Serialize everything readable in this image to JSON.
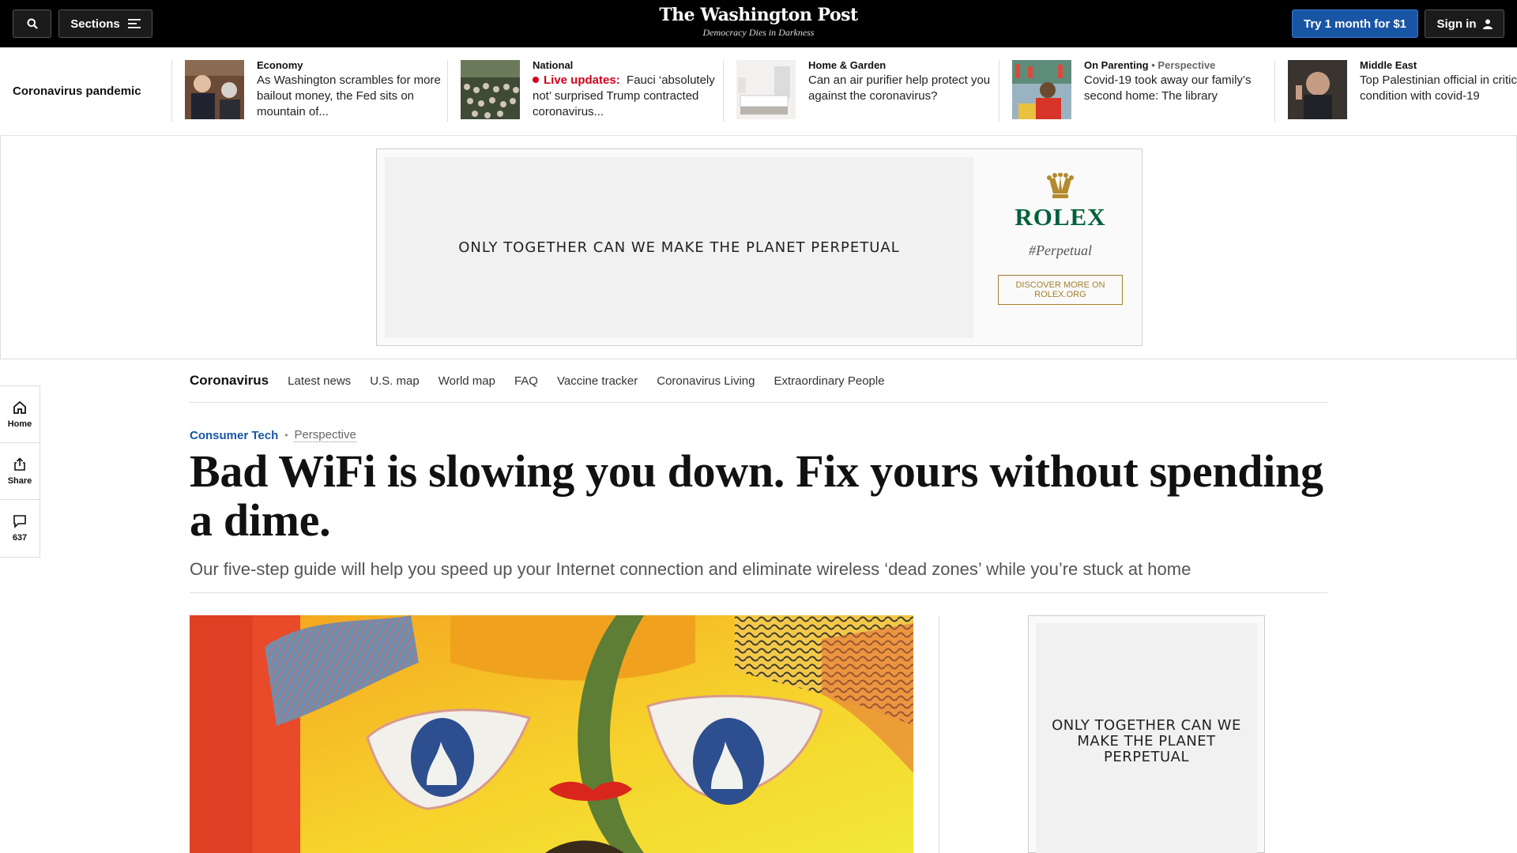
{
  "topbar": {
    "sections_label": "Sections",
    "logo": "The Washington Post",
    "tagline": "Democracy Dies in Darkness",
    "subscribe_label": "Try 1 month for $1",
    "signin_label": "Sign in",
    "icons": [
      "search-icon",
      "menu-icon",
      "user-icon"
    ]
  },
  "strip": {
    "title": "Coronavirus pandemic",
    "items": [
      {
        "kicker": "Economy",
        "headline": "As Washington scrambles for more bailout money, the Fed sits on mountain of..."
      },
      {
        "kicker": "National",
        "live": "Live updates:",
        "headline": "Fauci ‘absolutely not’ surprised Trump contracted coronavirus..."
      },
      {
        "kicker": "Home & Garden",
        "headline": "Can an air purifier help protect you against the coronavirus?"
      },
      {
        "kicker": "On Parenting",
        "kicker2": "• Perspective",
        "headline": "Covid-19 took away our family’s second home: The library"
      },
      {
        "kicker": "Middle East",
        "headline": "Top Palestinian official in critical condition with covid-19"
      }
    ]
  },
  "top_ad": {
    "text": "ONLY TOGETHER CAN WE MAKE THE PLANET PERPETUAL",
    "brand": "ROLEX",
    "hashtag": "#Perpetual",
    "cta": "DISCOVER MORE ON ROLEX.ORG",
    "brand_color": "#00603a"
  },
  "rail": {
    "home": "Home",
    "share": "Share",
    "comments": "637"
  },
  "subnav": {
    "title": "Coronavirus",
    "links": [
      "Latest news",
      "U.S. map",
      "World map",
      "FAQ",
      "Vaccine tracker",
      "Coronavirus Living",
      "Extraordinary People"
    ]
  },
  "article": {
    "kicker": "Consumer Tech",
    "label": "Perspective",
    "headline": "Bad WiFi is slowing you down. Fix yours without spending a dime.",
    "subhead": "Our five-step guide will help you speed up your Internet connection and eliminate wireless ‘dead zones’ while you’re stuck at home"
  },
  "side_ad": {
    "text": "ONLY TOGETHER CAN WE MAKE THE PLANET PERPETUAL"
  },
  "colors": {
    "accent_blue": "#1955a5",
    "live_red": "#d0021b"
  }
}
